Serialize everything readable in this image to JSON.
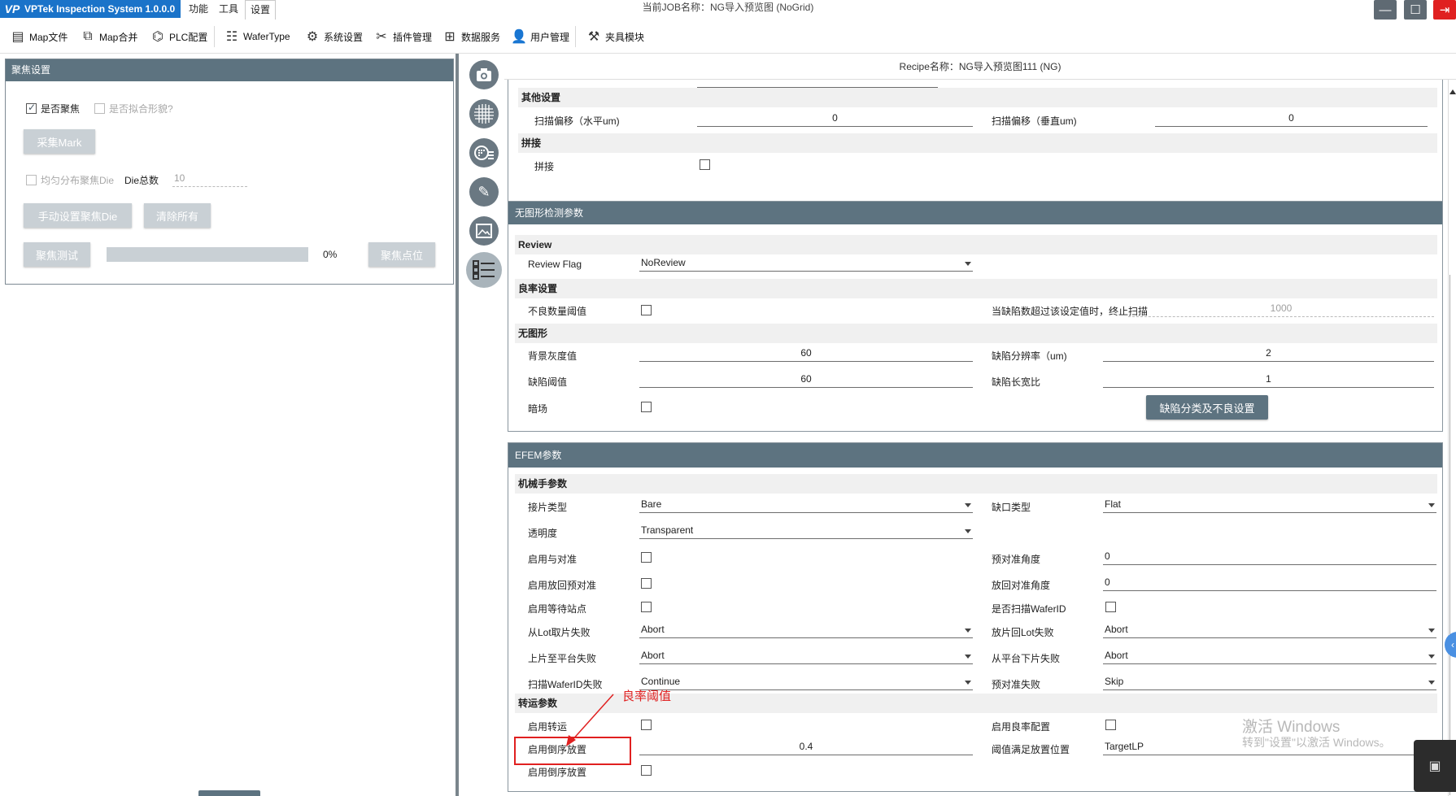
{
  "titlebar": {
    "app_logo": "VP",
    "app_title": "VPTek Inspection System 1.0.0.0",
    "menus": [
      "功能",
      "工具",
      "设置"
    ],
    "job_title": "当前JOB名称：NG导入预览图 (NoGrid)",
    "minimize_icon": "minimize-icon",
    "maximize_icon": "maximize-icon",
    "exit_icon": "exit-icon"
  },
  "toolbar": {
    "items": [
      {
        "label": "Map文件",
        "icon": "map-file-icon"
      },
      {
        "label": "Map合并",
        "icon": "map-merge-icon"
      },
      {
        "label": "PLC配置",
        "icon": "plc-icon"
      },
      {
        "label": "WaferType",
        "icon": "wafer-type-icon"
      },
      {
        "label": "系统设置",
        "icon": "gear-icon"
      },
      {
        "label": "插件管理",
        "icon": "plugin-icon"
      },
      {
        "label": "数据服务",
        "icon": "data-service-icon"
      },
      {
        "label": "用户管理",
        "icon": "user-icon"
      },
      {
        "label": "夹具模块",
        "icon": "fixture-icon"
      }
    ]
  },
  "focus_panel": {
    "title": "聚焦设置",
    "enable_focus": {
      "label": "是否聚焦",
      "checked": true
    },
    "fit_stage": {
      "label": "是否拟合形貌?",
      "checked": false
    },
    "collect_mark": "采集Mark",
    "uniform_die": {
      "label": "均匀分布聚焦Die",
      "checked": false
    },
    "die_total_label": "Die总数",
    "die_total_value": "10",
    "manual_focus_die": "手动设置聚焦Die",
    "clear_all": "清除所有",
    "focus_test": "聚焦测试",
    "progress_percent": "0%",
    "progress_value": 0,
    "focus_points": "聚焦点位"
  },
  "iconbar": [
    "camera-icon",
    "grid-icon",
    "wafer-map-icon",
    "tools-icon",
    "image-frame-icon",
    "checklist-icon"
  ],
  "recipe": {
    "title": "Recipe名称：NG导入预览图111 (NG)"
  },
  "other_settings": {
    "group_label": "其他设置",
    "scan_offset_h_label": "扫描偏移（水平um)",
    "scan_offset_h_value": "0",
    "scan_offset_v_label": "扫描偏移（垂直um)",
    "scan_offset_v_value": "0",
    "stitch_group_label": "拼接",
    "stitch_label": "拼接"
  },
  "no_pattern": {
    "header": "无图形检测参数",
    "review_group": "Review",
    "review_flag_label": "Review Flag",
    "review_flag_value": "NoReview",
    "yield_group": "良率设置",
    "bad_count_label": "不良数量阈值",
    "stop_scan_label": "当缺陷数超过该设定值时，终止扫描",
    "stop_scan_value": "1000",
    "nopattern_group": "无图形",
    "bg_gray_label": "背景灰度值",
    "bg_gray_value": "60",
    "defect_res_label": "缺陷分辨率（um)",
    "defect_res_value": "2",
    "defect_thresh_label": "缺陷阈值",
    "defect_thresh_value": "60",
    "defect_aspect_label": "缺陷长宽比",
    "defect_aspect_value": "1",
    "darkfield_label": "暗场",
    "classify_btn": "缺陷分类及不良设置"
  },
  "efem": {
    "header": "EFEM参数",
    "robot_group": "机械手参数",
    "pick_type_label": "接片类型",
    "pick_type_value": "Bare",
    "notch_type_label": "缺口类型",
    "notch_type_value": "Flat",
    "transparency_label": "透明度",
    "transparency_value": "Transparent",
    "enable_align_label": "启用与对准",
    "prealign_angle_label": "预对准角度",
    "prealign_angle_value": "0",
    "enable_return_prealign_label": "启用放回预对准",
    "return_align_angle_label": "放回对准角度",
    "return_align_angle_value": "0",
    "enable_wait_station_label": "启用等待站点",
    "scan_waferid_label": "是否扫描WaferID",
    "lot_pick_fail_label": "从Lot取片失败",
    "lot_pick_fail_value": "Abort",
    "lot_return_fail_label": "放片回Lot失败",
    "lot_return_fail_value": "Abort",
    "load_stage_fail_label": "上片至平台失败",
    "load_stage_fail_value": "Abort",
    "unload_stage_fail_label": "从平台下片失败",
    "unload_stage_fail_value": "Abort",
    "scan_waferid_fail_label": "扫描WaferID失败",
    "scan_waferid_fail_value": "Continue",
    "prealign_fail_label": "预对准失败",
    "prealign_fail_value": "Skip",
    "transfer_group": "转运参数",
    "enable_transfer_label": "启用转运",
    "enable_yield_config_label": "启用良率配置",
    "enable_reverse_label": "启用倒序放置",
    "yield_threshold_value": "0.4",
    "threshold_place_label": "阈值满足放置位置",
    "threshold_place_value": "TargetLP",
    "enable_reverse2_label": "启用倒序放置"
  },
  "annotation": {
    "text": "良率阈值",
    "color": "#e02020"
  },
  "watermark": {
    "line1": "激活 Windows",
    "line2": "转到\"设置\"以激活 Windows。"
  },
  "colors": {
    "accent_blue": "#1a73c9",
    "header_slate": "#5d7380",
    "close_red": "#e02020"
  }
}
